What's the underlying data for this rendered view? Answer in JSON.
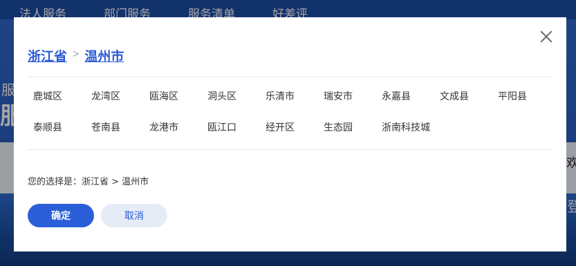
{
  "background": {
    "nav": [
      "法人服务",
      "部门服务",
      "服务清单",
      "好差评"
    ],
    "left_fragments": [
      "服",
      "服务"
    ],
    "right_fragments": [
      "欢",
      "登"
    ]
  },
  "modal": {
    "breadcrumb": [
      "浙江省",
      "温州市"
    ],
    "items_row1": [
      "鹿城区",
      "龙湾区",
      "瓯海区",
      "洞头区",
      "乐清市",
      "瑞安市",
      "永嘉县",
      "文成县",
      "平阳县"
    ],
    "items_row2": [
      "泰顺县",
      "苍南县",
      "龙港市",
      "瓯江口",
      "经开区",
      "生态园",
      "浙南科技城"
    ],
    "selection_text": "您的选择是：浙江省 > 温州市",
    "confirm_label": "确定",
    "cancel_label": "取消"
  },
  "colors": {
    "accent": "#2b5fd9",
    "link": "#2a5bd7",
    "cancel_bg": "#e6ecf7"
  }
}
